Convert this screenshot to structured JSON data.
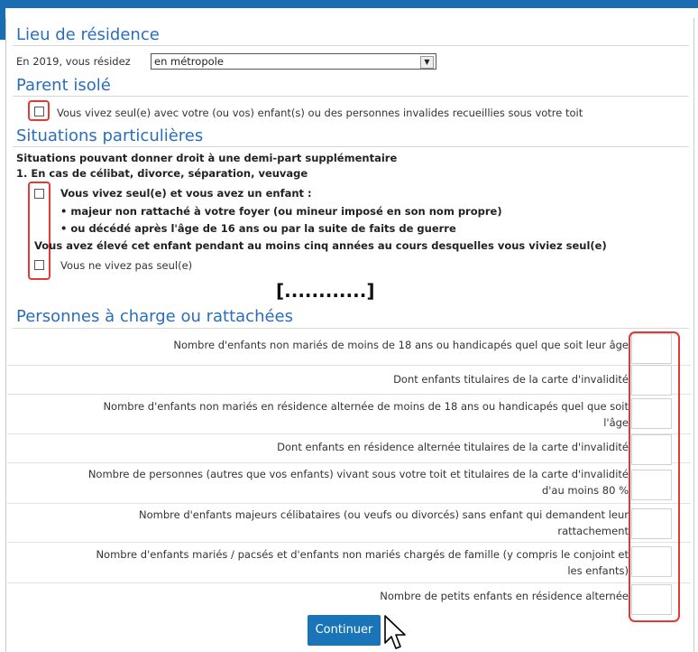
{
  "residence": {
    "title": "Lieu de résidence",
    "label": "En 2019, vous résidez",
    "selected": "en métropole"
  },
  "parent_isole": {
    "title": "Parent isolé",
    "checkbox_label": "Vous vivez seul(e) avec votre (ou vos) enfant(s) ou des personnes invalides recueillies sous votre toit"
  },
  "situations": {
    "title": "Situations particulières",
    "intro": "Situations pouvant donner droit à une demi-part supplémentaire",
    "case1": "1. En cas de célibat, divorce, séparation, veuvage",
    "cb1_label": "Vous vivez seul(e) et vous avez un enfant :",
    "bullet1": "majeur non rattaché à votre foyer (ou mineur imposé en son nom propre)",
    "bullet2": "ou décédé après l'âge de 16 ans ou par la suite de faits de guerre",
    "raised_line": "Vous avez élevé cet enfant pendant au moins cinq années au cours desquelles vous viviez seul(e)",
    "cb2_label": "Vous ne vivez pas seul(e)"
  },
  "ellipsis": "[............]",
  "dependents": {
    "title": "Personnes à charge ou rattachées",
    "rows": [
      {
        "line1": "Nombre d'enfants non mariés de moins de 18 ans ou handicapés quel que soit leur âge",
        "line2": ""
      },
      {
        "line1": "Dont enfants titulaires de la carte d'invalidité",
        "line2": ""
      },
      {
        "line1": "Nombre d'enfants non mariés en résidence alternée de moins de 18 ans ou handicapés quel que soit",
        "line2": "l'âge"
      },
      {
        "line1": "Dont enfants en résidence alternée titulaires de la carte d'invalidité",
        "line2": ""
      },
      {
        "line1": "Nombre de personnes (autres que vos enfants) vivant sous votre toit et titulaires de la carte d'invalidité",
        "line2": "d'au moins 80 %"
      },
      {
        "line1": "Nombre d'enfants majeurs célibataires (ou veufs ou divorcés) sans enfant qui demandent leur",
        "line2": "rattachement"
      },
      {
        "line1": "Nombre d'enfants mariés / pacsés et d'enfants non mariés chargés de famille (y compris le conjoint et",
        "line2": "les enfants)"
      },
      {
        "line1": "Nombre de petits enfants en résidence alternée",
        "line2": ""
      }
    ]
  },
  "continue_label": "Continuer",
  "colors": {
    "accent": "#1a75b8",
    "heading": "#2a6ebb",
    "highlight": "#e53935"
  }
}
